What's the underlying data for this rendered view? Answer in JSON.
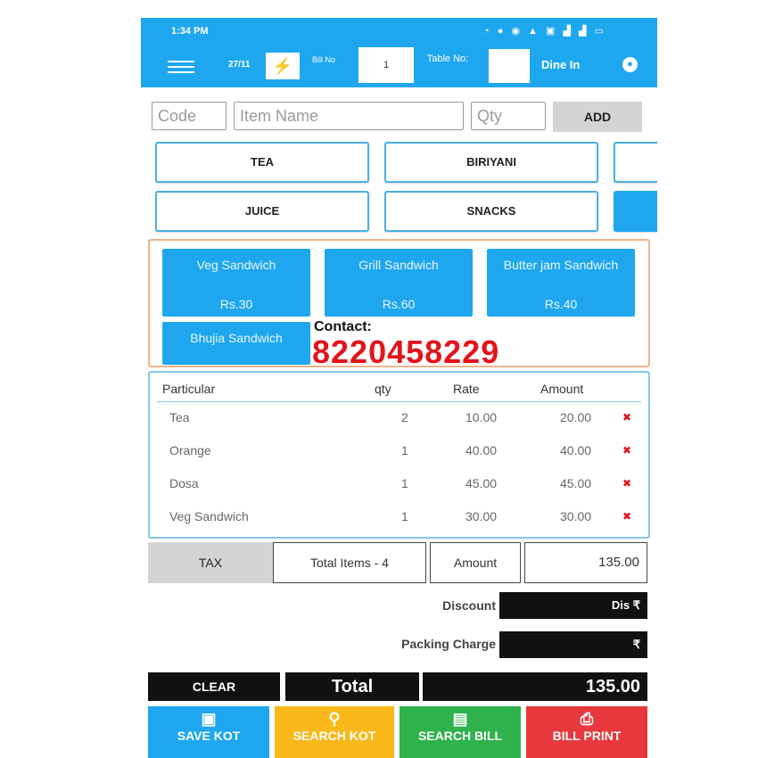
{
  "status": {
    "time": "1:34 PM",
    "icons": "◔ ● ◉   ▲ ▣ ▟ ▟ ▭"
  },
  "header": {
    "date": "27/11",
    "bill_no_label": "Bill No",
    "bill_no_value": "1",
    "table_no_label": "Table No:",
    "table_no_value": "",
    "mode": "Dine In"
  },
  "inputs": {
    "code_placeholder": "Code",
    "item_name_placeholder": "Item Name",
    "qty_placeholder": "Qty",
    "add_label": "ADD"
  },
  "categories": [
    "TEA",
    "BIRIYANI",
    "JUICE",
    "SNACKS"
  ],
  "items": [
    {
      "name": "Veg Sandwich",
      "price": "Rs.30"
    },
    {
      "name": "Grill Sandwich",
      "price": "Rs.60"
    },
    {
      "name": "Butter jam Sandwich",
      "price": "Rs.40"
    },
    {
      "name": "Bhujia Sandwich",
      "price": ""
    }
  ],
  "contact": {
    "label": "Contact:",
    "number": "8220458229"
  },
  "order": {
    "headers": [
      "Particular",
      "qty",
      "Rate",
      "Amount"
    ],
    "rows": [
      {
        "particular": "Tea",
        "qty": "2",
        "rate": "10.00",
        "amount": "20.00"
      },
      {
        "particular": "Orange",
        "qty": "1",
        "rate": "40.00",
        "amount": "40.00"
      },
      {
        "particular": "Dosa",
        "qty": "1",
        "rate": "45.00",
        "amount": "45.00"
      },
      {
        "particular": "Veg Sandwich",
        "qty": "1",
        "rate": "30.00",
        "amount": "30.00"
      }
    ],
    "delete_glyph": "✖"
  },
  "totals": {
    "tax_label": "TAX",
    "total_items": "Total Items - 4",
    "amount_label": "Amount",
    "amount_value": "135.00",
    "discount_label": "Discount",
    "discount_value": "Dis ₹",
    "packing_label": "Packing Charge",
    "packing_value": "₹",
    "clear_label": "CLEAR",
    "total_label": "Total",
    "total_value": "135.00"
  },
  "actions": [
    {
      "label": "SAVE KOT",
      "color": "#1ea7ef",
      "icon": "floppy-icon"
    },
    {
      "label": "SEARCH KOT",
      "color": "#f9b91b",
      "icon": "search-icon"
    },
    {
      "label": "SEARCH BILL",
      "color": "#2eb24b",
      "icon": "receipt-icon"
    },
    {
      "label": "BILL PRINT",
      "color": "#e8383d",
      "icon": "printer-icon"
    }
  ]
}
